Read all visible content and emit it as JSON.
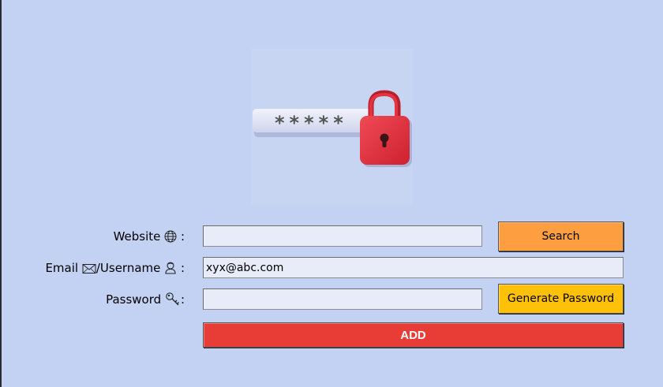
{
  "form": {
    "website": {
      "label": "Website",
      "separator": " :",
      "icon": "globe-icon",
      "value": ""
    },
    "email": {
      "label_email": "Email",
      "label_username": "/Username",
      "separator": " :",
      "icons": [
        "envelope-icon",
        "user-icon"
      ],
      "value": "xyx@abc.com"
    },
    "password": {
      "label": "Password",
      "separator": ":",
      "icon": "key-icon",
      "value": ""
    }
  },
  "logo": {
    "mask_text": "*****",
    "icon": "padlock-icon"
  },
  "buttons": {
    "search": "Search",
    "generate": "Generate Password",
    "add": "ADD"
  },
  "colors": {
    "background": "#c3d1f3",
    "search_button": "#fd9e41",
    "generate_button": "#fec107",
    "add_button": "#e83c37",
    "lock": "#e2333f",
    "field": "#e8ebf8"
  }
}
